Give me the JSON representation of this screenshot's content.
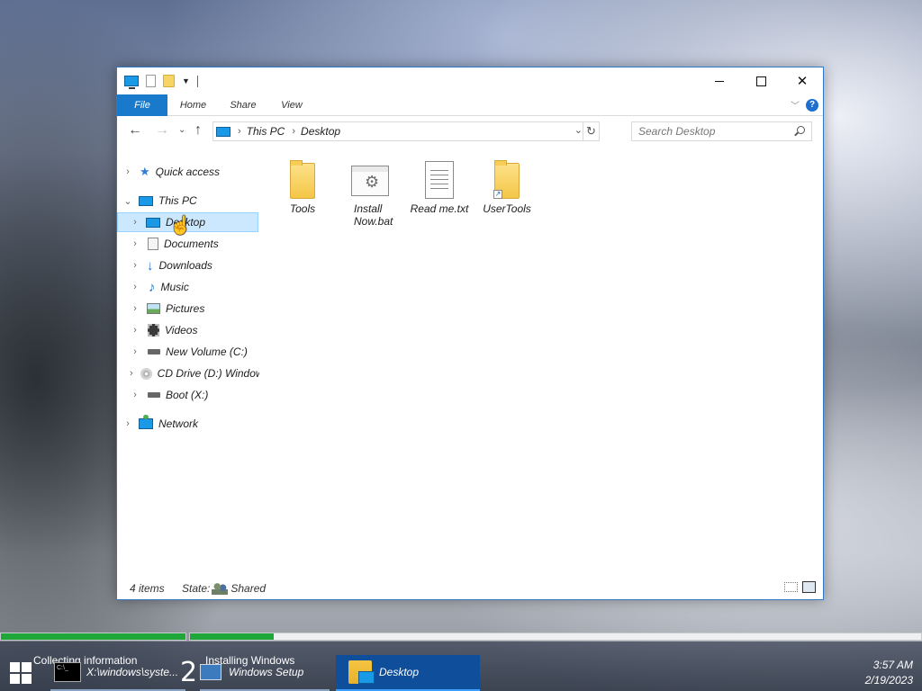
{
  "explorer": {
    "ribbon_tabs": {
      "file": "File",
      "home": "Home",
      "share": "Share",
      "view": "View"
    },
    "window_buttons": {
      "minimize": "",
      "maximize": "",
      "close": "✕"
    },
    "help_label": "?",
    "address": {
      "root": "This PC",
      "current": "Desktop"
    },
    "search": {
      "placeholder": "Search Desktop",
      "value": ""
    },
    "nav": {
      "quick_access": "Quick access",
      "this_pc": "This PC",
      "desktop": "Desktop",
      "documents": "Documents",
      "downloads": "Downloads",
      "music": "Music",
      "pictures": "Pictures",
      "videos": "Videos",
      "c_drive": "New Volume (C:)",
      "d_drive": "CD Drive (D:) Windows",
      "x_drive": "Boot (X:)",
      "network": "Network"
    },
    "files": [
      {
        "name": "Tools",
        "type": "folder"
      },
      {
        "name": "Install\nNow.bat",
        "type": "bat"
      },
      {
        "name": "Read me.txt",
        "type": "txt"
      },
      {
        "name": "UserTools",
        "type": "folder-shortcut"
      }
    ],
    "status": {
      "count": "4 items",
      "state_label": "State:",
      "state_value": "Shared"
    }
  },
  "setup": {
    "phase1_label": "Collecting information",
    "phase2_number": "2",
    "phase2_label": "Installing Windows",
    "phase1_progress": 1.0,
    "phase2_progress": 0.115
  },
  "taskbar": {
    "items": [
      {
        "label": "X:\\windows\\syste..."
      },
      {
        "label": "Windows Setup"
      },
      {
        "label": "Desktop"
      }
    ],
    "cmd_icon_text": "C:\\_",
    "time": "3:57 AM",
    "date": "2/19/2023"
  },
  "colors": {
    "accent": "#1979ca",
    "selection": "#cce8ff",
    "progress": "#1fa73a"
  }
}
